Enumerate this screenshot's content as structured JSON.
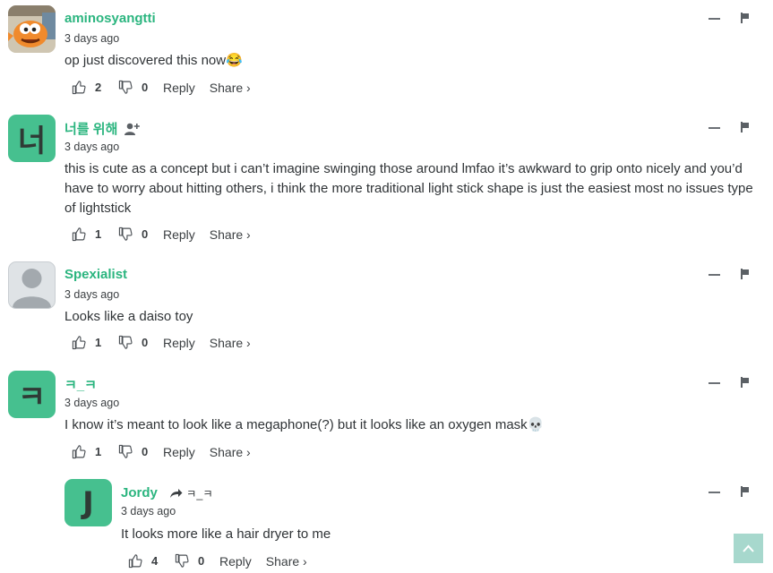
{
  "comments": [
    {
      "username": "aminosyangtti",
      "time": "3 days ago",
      "text": "op just discovered this now😂",
      "likes": "2",
      "dislikes": "0",
      "reply_label": "Reply",
      "share_label": "Share ›"
    },
    {
      "username": "너를 위해",
      "avatar_letter": "너",
      "time": "3 days ago",
      "text": "this is cute as a concept but i can’t imagine swinging those around lmfao it’s awkward to grip onto nicely and you’d have to worry about hitting others, i think the more traditional light stick shape is just the easiest most no issues type of lightstick",
      "likes": "1",
      "dislikes": "0",
      "reply_label": "Reply",
      "share_label": "Share ›"
    },
    {
      "username": "Spexialist",
      "time": "3 days ago",
      "text": "Looks like a daiso toy",
      "likes": "1",
      "dislikes": "0",
      "reply_label": "Reply",
      "share_label": "Share ›"
    },
    {
      "username": "ㅋ_ㅋ",
      "avatar_letter": "ㅋ",
      "time": "3 days ago",
      "text": "I know it’s meant to look like a megaphone(?) but it looks like an oxygen mask💀",
      "likes": "1",
      "dislikes": "0",
      "reply_label": "Reply",
      "share_label": "Share ›"
    },
    {
      "username": "Jordy",
      "avatar_letter": "J",
      "reply_to": "ㅋ_ㅋ",
      "time": "3 days ago",
      "text": "It looks more like a hair dryer to me",
      "likes": "4",
      "dislikes": "0",
      "reply_label": "Reply",
      "share_label": "Share ›"
    }
  ],
  "colors": {
    "accent": "#2bb57f",
    "avatar_green": "#46c08f",
    "scroll_top": "#a7d8cd"
  }
}
